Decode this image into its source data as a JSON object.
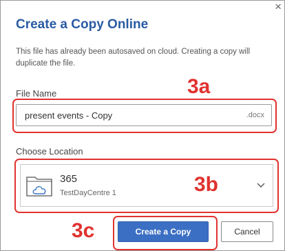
{
  "dialog": {
    "title": "Create a Copy Online",
    "close_glyph": "×",
    "description": "This file has already been autosaved on cloud. Creating a copy will duplicate the file."
  },
  "file_name": {
    "label": "File Name",
    "value": "present events - Copy",
    "extension": ".docx"
  },
  "location": {
    "label": "Choose Location",
    "name": "365",
    "subtitle": "TestDayCentre 1",
    "icon": "cloud-folder-icon"
  },
  "buttons": {
    "create": "Create a Copy",
    "cancel": "Cancel"
  },
  "annotations": {
    "a": "3a",
    "b": "3b",
    "c": "3c",
    "color": "#e0322f"
  }
}
